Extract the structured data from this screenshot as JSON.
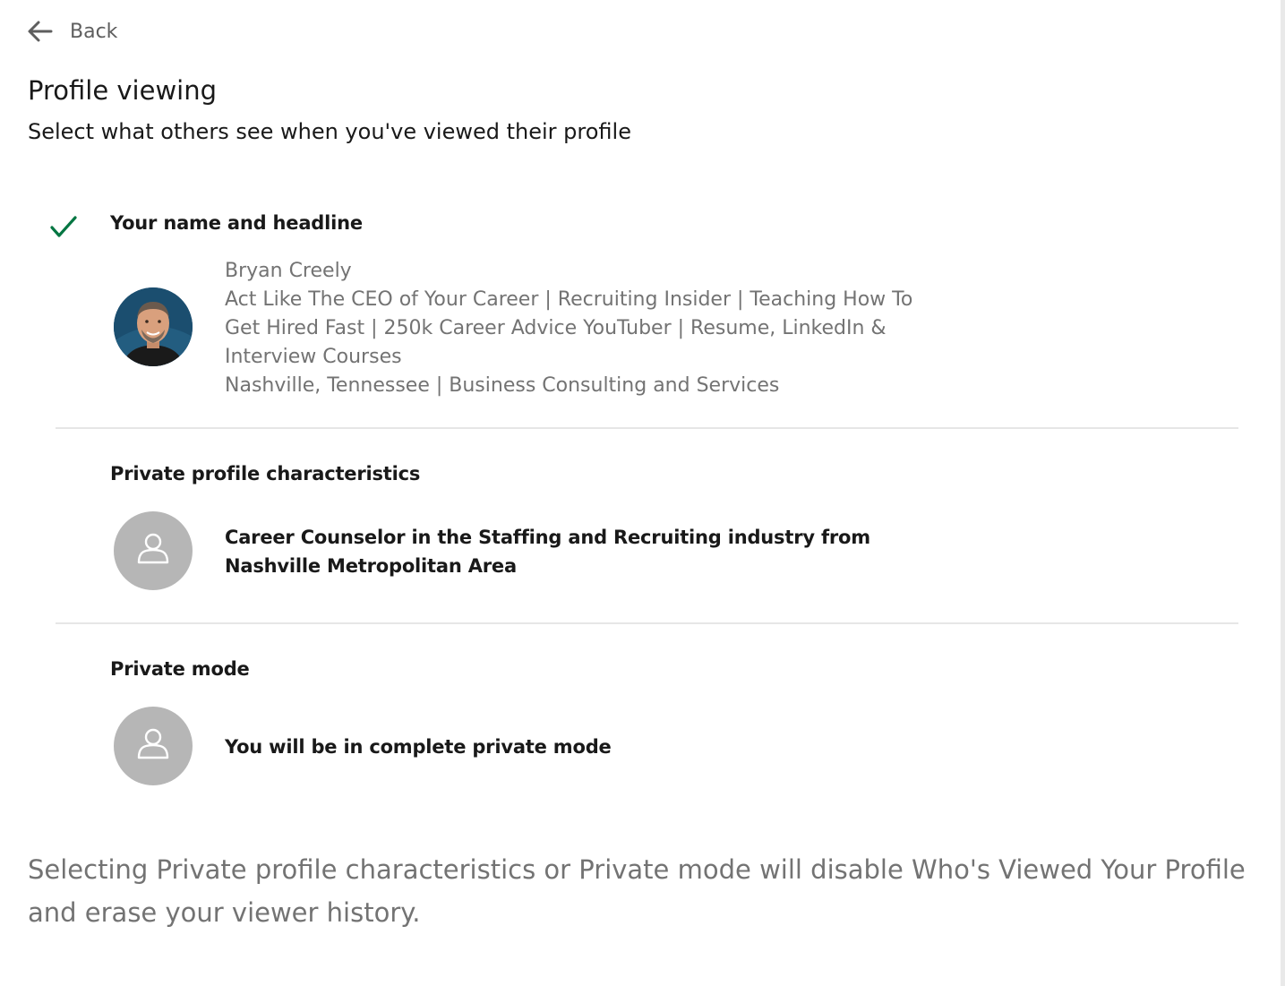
{
  "header": {
    "back_label": "Back"
  },
  "page": {
    "title": "Profile viewing",
    "subtitle": "Select what others see when you've viewed their profile"
  },
  "options": [
    {
      "title": "Your name and headline",
      "selected": true,
      "profile": {
        "name": "Bryan Creely",
        "headline_lines": [
          "Act Like The CEO of Your Career | Recruiting Insider | Teaching How To",
          "Get Hired Fast | 250k Career Advice YouTuber | Resume, LinkedIn &",
          "Interview Courses"
        ],
        "location": "Nashville, Tennessee | Business Consulting and Services"
      }
    },
    {
      "title": "Private profile characteristics",
      "selected": false,
      "description_lines": [
        "Career Counselor in the Staffing and Recruiting industry from",
        "Nashville Metropolitan Area"
      ]
    },
    {
      "title": "Private mode",
      "selected": false,
      "description": "You will be in complete private mode"
    }
  ],
  "footer": {
    "note_lines": [
      "Selecting Private profile characteristics or Private mode will disable Who's Viewed Your Profile",
      "and erase your viewer history."
    ]
  },
  "icons": {
    "back": "arrow-left-icon",
    "selected": "checkmark-icon",
    "anonymous_avatar": "person-outline-icon"
  },
  "colors": {
    "check_green": "#057642",
    "avatar_gray": "#b6b6b6",
    "muted_text": "#737373",
    "divider": "#e6e6e6"
  }
}
